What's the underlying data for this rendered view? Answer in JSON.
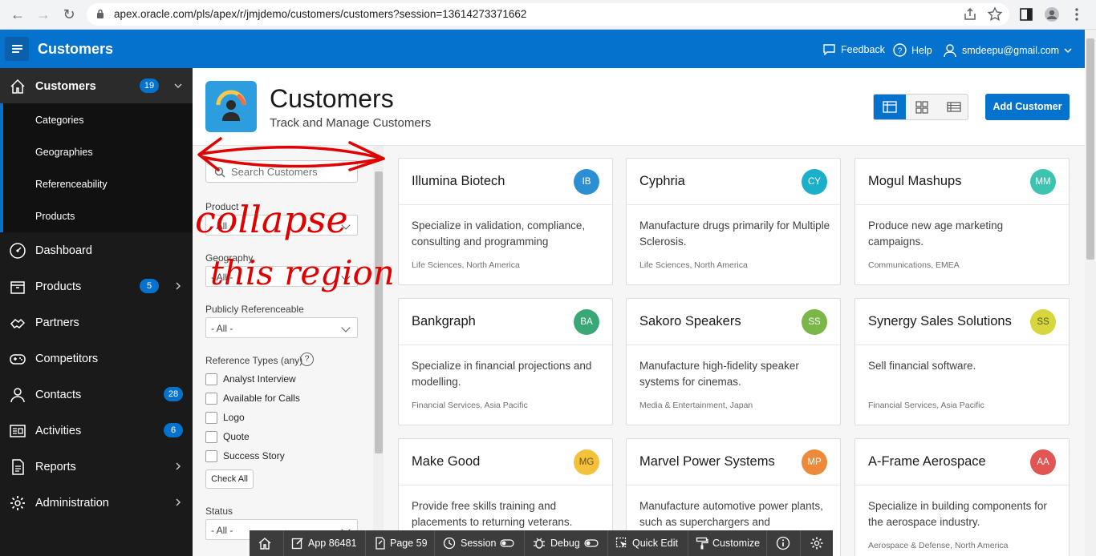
{
  "browser": {
    "url": "apex.oracle.com/pls/apex/r/jmjdemo/customers/customers?session=13614273371662"
  },
  "header": {
    "app_title": "Customers",
    "feedback": "Feedback",
    "help": "Help",
    "user": "smdeepu@gmail.com"
  },
  "sidebar": {
    "items": [
      {
        "label": "Customers",
        "badge": "19",
        "icon": "home-icon"
      },
      {
        "label": "Dashboard",
        "icon": "dashboard-icon"
      },
      {
        "label": "Products",
        "badge": "5",
        "icon": "box-icon"
      },
      {
        "label": "Partners",
        "icon": "handshake-icon"
      },
      {
        "label": "Competitors",
        "icon": "gamepad-icon"
      },
      {
        "label": "Contacts",
        "badge": "28",
        "icon": "user-icon"
      },
      {
        "label": "Activities",
        "badge": "6",
        "icon": "newspaper-icon"
      },
      {
        "label": "Reports",
        "icon": "report-icon"
      },
      {
        "label": "Administration",
        "icon": "gear-icon"
      }
    ],
    "sub_items": [
      "Categories",
      "Geographies",
      "Referenceability",
      "Products"
    ]
  },
  "hero": {
    "title": "Customers",
    "subtitle": "Track and Manage Customers",
    "add_button": "Add Customer"
  },
  "facets": {
    "search_placeholder": "Search Customers",
    "product_label": "Product",
    "product_value": "- All -",
    "geography_label": "Geography",
    "geography_value": "- All -",
    "publicly_label": "Publicly Referenceable",
    "publicly_value": "- All -",
    "ref_types_label": "Reference Types (any)",
    "ref_types": [
      "Analyst Interview",
      "Available for Calls",
      "Logo",
      "Quote",
      "Success Story"
    ],
    "check_all": "Check All",
    "status_label": "Status",
    "status_value": "- All -"
  },
  "cards": [
    {
      "name": "Illumina Biotech",
      "initials": "IB",
      "color": "#2c8fd4",
      "desc": "Specialize in validation, compliance, consulting and programming",
      "meta": "Life Sciences, North America"
    },
    {
      "name": "Cyphria",
      "initials": "CY",
      "color": "#1ab0c9",
      "desc": "Manufacture drugs primarily for Multiple Sclerosis.",
      "meta": "Life Sciences, North America"
    },
    {
      "name": "Mogul Mashups",
      "initials": "MM",
      "color": "#3cc4b0",
      "desc": "Produce new age marketing campaigns.",
      "meta": "Communications, EMEA"
    },
    {
      "name": "Bankgraph",
      "initials": "BA",
      "color": "#3aa876",
      "desc": "Specialize in financial projections and modelling.",
      "meta": "Financial Services, Asia Pacific"
    },
    {
      "name": "Sakoro Speakers",
      "initials": "SS",
      "color": "#7ab648",
      "desc": "Manufacture high-fidelity speaker systems for cinemas.",
      "meta": "Media & Entertainment, Japan"
    },
    {
      "name": "Synergy Sales Solutions",
      "initials": "SS",
      "color": "#d7d63c",
      "desc": "Sell financial software.",
      "meta": "Financial Services, Asia Pacific"
    },
    {
      "name": "Make Good",
      "initials": "MG",
      "color": "#f3c23a",
      "desc": "Provide free skills training and placements to returning veterans.",
      "meta": ""
    },
    {
      "name": "Marvel Power Systems",
      "initials": "MP",
      "color": "#ec8a3a",
      "desc": "Manufacture automotive power plants, such as superchargers and",
      "meta": ""
    },
    {
      "name": "A-Frame Aerospace",
      "initials": "AA",
      "color": "#e15552",
      "desc": "Specialize in building components for the aerospace industry.",
      "meta": "Aerospace & Defense, North America"
    }
  ],
  "dev_toolbar": {
    "app": "App 86481",
    "page": "Page 59",
    "session": "Session",
    "debug": "Debug",
    "quick_edit": "Quick Edit",
    "customize": "Customize"
  },
  "annotation": {
    "line1": "collapse",
    "line2": "this region"
  }
}
